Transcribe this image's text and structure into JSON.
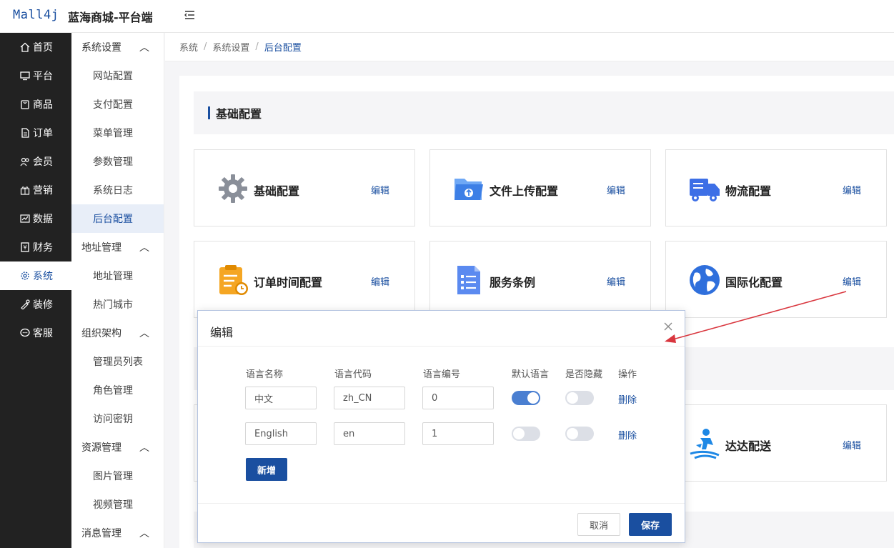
{
  "header": {
    "logo": "Mall4j",
    "title": "蓝海商城-平台端"
  },
  "leftnav": [
    {
      "label": "首页",
      "icon": "home-icon"
    },
    {
      "label": "平台",
      "icon": "monitor-icon"
    },
    {
      "label": "商品",
      "icon": "bag-icon"
    },
    {
      "label": "订单",
      "icon": "document-icon"
    },
    {
      "label": "会员",
      "icon": "users-icon"
    },
    {
      "label": "营销",
      "icon": "gift-icon"
    },
    {
      "label": "数据",
      "icon": "chart-icon"
    },
    {
      "label": "财务",
      "icon": "ledger-icon"
    },
    {
      "label": "系统",
      "icon": "gear-icon",
      "active": true
    },
    {
      "label": "装修",
      "icon": "brush-icon"
    },
    {
      "label": "客服",
      "icon": "chat-icon"
    }
  ],
  "subnav": {
    "groups": [
      {
        "label": "系统设置",
        "items": [
          "网站配置",
          "支付配置",
          "菜单管理",
          "参数管理",
          "系统日志",
          "后台配置"
        ]
      },
      {
        "label": "地址管理",
        "items": [
          "地址管理",
          "热门城市"
        ]
      },
      {
        "label": "组织架构",
        "items": [
          "管理员列表",
          "角色管理",
          "访问密钥"
        ]
      },
      {
        "label": "资源管理",
        "items": [
          "图片管理",
          "视频管理"
        ]
      },
      {
        "label": "消息管理",
        "items": []
      }
    ],
    "active": "后台配置"
  },
  "breadcrumb": {
    "b1": "系统",
    "b2": "系统设置",
    "b3": "后台配置"
  },
  "section": {
    "title": "基础配置"
  },
  "cards": [
    {
      "title": "基础配置",
      "edit": "编辑",
      "icon": "gear-icon"
    },
    {
      "title": "文件上传配置",
      "edit": "编辑",
      "icon": "folder-upload-icon"
    },
    {
      "title": "物流配置",
      "edit": "编辑",
      "icon": "truck-icon"
    },
    {
      "title": "订单时间配置",
      "edit": "编辑",
      "icon": "clipboard-clock-icon"
    },
    {
      "title": "服务条例",
      "edit": "编辑",
      "icon": "checklist-icon"
    },
    {
      "title": "国际化配置",
      "edit": "编辑",
      "icon": "globe-icon"
    },
    {
      "title": "达达配送",
      "edit": "编辑",
      "icon": "courier-icon"
    }
  ],
  "modal": {
    "title": "编辑",
    "columns": {
      "name": "语言名称",
      "code": "语言代码",
      "number": "语言编号",
      "default": "默认语言",
      "hidden": "是否隐藏",
      "action": "操作"
    },
    "rows": [
      {
        "name": "中文",
        "code": "zh_CN",
        "number": "0",
        "default": true,
        "hidden": false,
        "delete": "删除"
      },
      {
        "name": "English",
        "code": "en",
        "number": "1",
        "default": false,
        "hidden": false,
        "delete": "删除"
      }
    ],
    "add": "新增",
    "cancel": "取消",
    "save": "保存"
  },
  "colors": {
    "accent": "#1a4fa0",
    "nav_bg": "#222222",
    "toggle_on": "#4a7fd1",
    "annotation_arrow": "#d9363e"
  }
}
